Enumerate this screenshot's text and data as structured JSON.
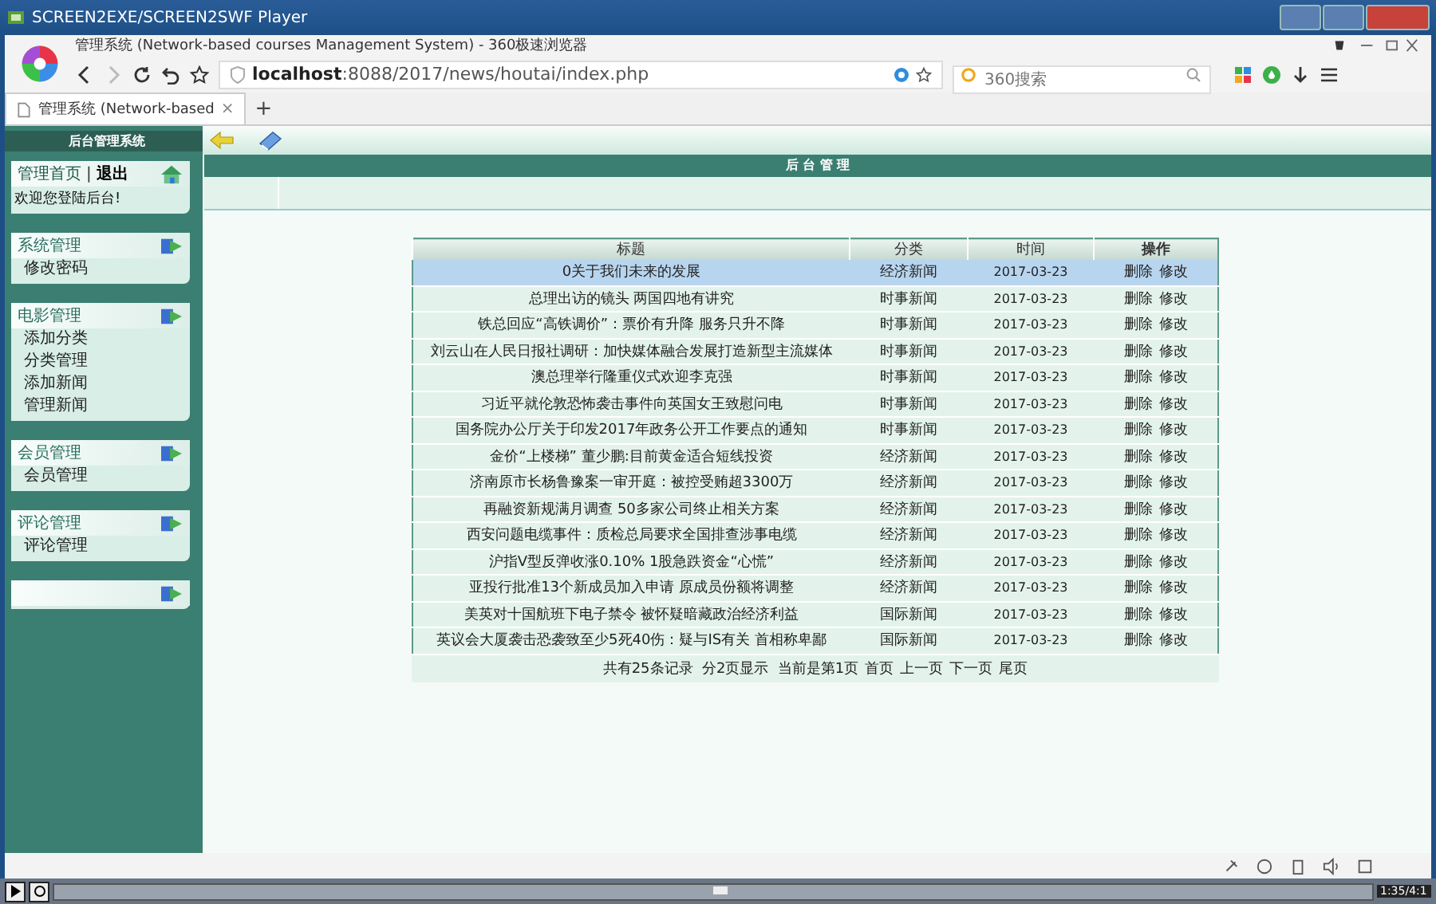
{
  "player": {
    "title": "SCREEN2EXE/SCREEN2SWF Player",
    "time": "1:35/4:1"
  },
  "browser": {
    "title": "管理系统 (Network-based courses Management System) - 360极速浏览器",
    "address_host": "localhost",
    "address_path": ":8088/2017/news/houtai/index.php",
    "search": {
      "placeholder": "360搜索"
    },
    "tabs": [
      {
        "label": "管理系统 (Network-based",
        "close": "×",
        "selected": true
      }
    ],
    "new_tab": "+"
  },
  "sidebar": {
    "heading": "后台管理系统",
    "top_panel": {
      "links": [
        "管理首页",
        "退出"
      ],
      "separator": "|",
      "welcome": "欢迎您登陆后台!"
    },
    "groups": [
      {
        "kind": "menu",
        "title": "系统管理",
        "items": [
          "修改密码"
        ]
      },
      {
        "kind": "menu",
        "title": "电影管理",
        "items": [
          "添加分类",
          "分类管理",
          "添加新闻",
          "管理新闻"
        ]
      },
      {
        "kind": "menu",
        "title": "会员管理",
        "items": [
          "会员管理"
        ]
      },
      {
        "kind": "menu",
        "title": "评论管理",
        "items": [
          "评论管理"
        ]
      },
      {
        "kind": "empty"
      }
    ]
  },
  "main": {
    "panel_title": "后 台 管 理",
    "table": {
      "columns": [
        "标题",
        "分类",
        "时间",
        "操作"
      ],
      "rows": [
        {
          "title": "0关于我们未来的发展",
          "category": "经济新闻",
          "time": "2017-03-23",
          "actions": [
            "删除",
            "修改"
          ],
          "selected": true
        },
        {
          "title": "总理出访的镜头 两国四地有讲究",
          "category": "时事新闻",
          "time": "2017-03-23",
          "actions": [
            "删除",
            "修改"
          ],
          "selected": false
        },
        {
          "title": "铁总回应“高铁调价”：票价有升降 服务只升不降",
          "category": "时事新闻",
          "time": "2017-03-23",
          "actions": [
            "删除",
            "修改"
          ],
          "selected": false
        },
        {
          "title": "刘云山在人民日报社调研：加快媒体融合发展打造新型主流媒体",
          "category": "时事新闻",
          "time": "2017-03-23",
          "actions": [
            "删除",
            "修改"
          ],
          "selected": false
        },
        {
          "title": "澳总理举行隆重仪式欢迎李克强",
          "category": "时事新闻",
          "time": "2017-03-23",
          "actions": [
            "删除",
            "修改"
          ],
          "selected": false
        },
        {
          "title": "习近平就伦敦恐怖袭击事件向英国女王致慰问电",
          "category": "时事新闻",
          "time": "2017-03-23",
          "actions": [
            "删除",
            "修改"
          ],
          "selected": false
        },
        {
          "title": "国务院办公厅关于印发2017年政务公开工作要点的通知",
          "category": "时事新闻",
          "time": "2017-03-23",
          "actions": [
            "删除",
            "修改"
          ],
          "selected": false
        },
        {
          "title": "金价“上楼梯” 董少鹏:目前黄金适合短线投资",
          "category": "经济新闻",
          "time": "2017-03-23",
          "actions": [
            "删除",
            "修改"
          ],
          "selected": false
        },
        {
          "title": "济南原市长杨鲁豫案一审开庭：被控受贿超3300万",
          "category": "经济新闻",
          "time": "2017-03-23",
          "actions": [
            "删除",
            "修改"
          ],
          "selected": false
        },
        {
          "title": "再融资新规满月调查 50多家公司终止相关方案",
          "category": "经济新闻",
          "time": "2017-03-23",
          "actions": [
            "删除",
            "修改"
          ],
          "selected": false
        },
        {
          "title": "西安问题电缆事件：质检总局要求全国排查涉事电缆",
          "category": "经济新闻",
          "time": "2017-03-23",
          "actions": [
            "删除",
            "修改"
          ],
          "selected": false
        },
        {
          "title": "沪指V型反弹收涨0.10% 1股急跌资金“心慌”",
          "category": "经济新闻",
          "time": "2017-03-23",
          "actions": [
            "删除",
            "修改"
          ],
          "selected": false
        },
        {
          "title": "亚投行批准13个新成员加入申请 原成员份额将调整",
          "category": "经济新闻",
          "time": "2017-03-23",
          "actions": [
            "删除",
            "修改"
          ],
          "selected": false
        },
        {
          "title": "美英对十国航班下电子禁令 被怀疑暗藏政治经济利益",
          "category": "国际新闻",
          "time": "2017-03-23",
          "actions": [
            "删除",
            "修改"
          ],
          "selected": false
        },
        {
          "title": "英议会大厦袭击恐袭致至少5死40伤：疑与IS有关 首相称卑鄙",
          "category": "国际新闻",
          "time": "2017-03-23",
          "actions": [
            "删除",
            "修改"
          ],
          "selected": false
        }
      ],
      "footer": {
        "summary": "共有25条记录  分2页显示  当前是第1页",
        "links": [
          "首页",
          "上一页",
          "下一页",
          "尾页"
        ]
      }
    }
  }
}
